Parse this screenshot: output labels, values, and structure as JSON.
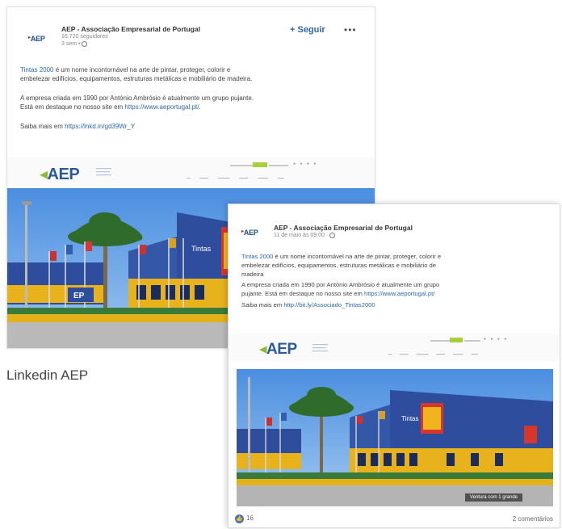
{
  "linkedin_post": {
    "org_logo": "AEP",
    "org_name": "AEP - Associação Empresarial de Portugal",
    "followers": "16.720 seguidores",
    "time": "3 sem •",
    "follow_label": "+ Seguir",
    "more_label": "•••",
    "body": {
      "line1_link": "Tintas 2000",
      "line1_rest": " é um nome incontornável na arte de pintar, proteger, colorir e",
      "line2": "embelezar edifícios, equipamentos, estruturas metálicas e mobiliário de madeira.",
      "line3": "A empresa criada em 1990 por António Ambrósio é atualmente um grupo pujante.",
      "line4_pre": "Está em destaque no nosso site em ",
      "line4_link": "https://www.aeportugal.pt/",
      "line4_post": ".",
      "line5_pre": "Saiba mais em ",
      "line5_link": "https://lnkd.in/gd39Wr_Y"
    },
    "banner_logo": "AEP",
    "caption": "Linkedin AEP"
  },
  "facebook_post": {
    "org_logo": "AEP",
    "org_name": "AEP - Associação Empresarial de Portugal",
    "time": "11 de maio às 09:00 ·",
    "body": {
      "line1_link": "Tintas 2000",
      "line1_rest": " é um nome incontornável na arte de pintar, proteger, colorir e",
      "line2": "embelezar edifícios, equipamentos, estruturas metálicas e mobiliário de",
      "line3": "madeira",
      "line4": "A empresa criada em 1990 por António Ambrósio é atualmente um grupo",
      "line5_pre": "pujante. Está em destaque no nosso site em ",
      "line5_link": "https://www.aeportugal.pt/",
      "line6_pre": "Saiba mais em ",
      "line6_link": "http://bit.ly/Associado_Tintas2000"
    },
    "banner_logo": "AEP",
    "photo_tag": "Ventura com 1 grande",
    "likes": "16",
    "comments": "2 comentários"
  },
  "icons": {
    "globe": "globe-icon",
    "like": "like-icon"
  },
  "colors": {
    "brand_blue": "#2a5a9a",
    "link_blue": "#2c68b0",
    "accent_green": "#a6cf3a",
    "building_blue": "#2e4d9c",
    "building_yellow": "#e8b21c"
  }
}
